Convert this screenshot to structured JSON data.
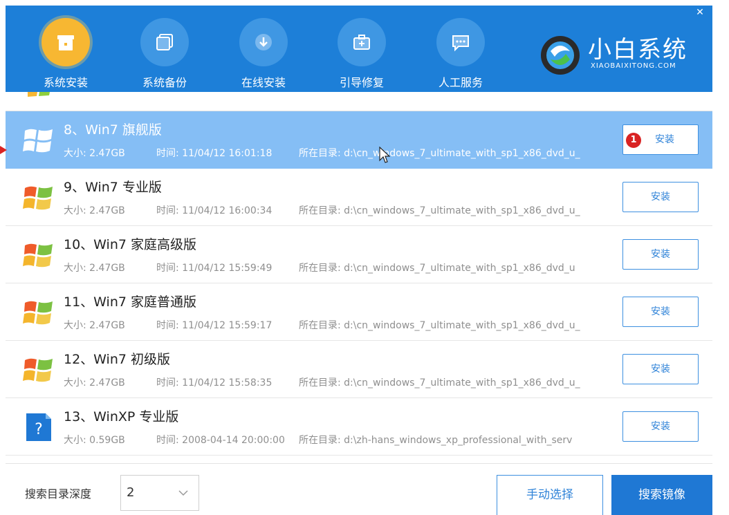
{
  "window": {
    "close_glyph": "✕"
  },
  "nav": {
    "items": [
      {
        "label": "系统安装",
        "icon": "install-box-icon",
        "active": true
      },
      {
        "label": "系统备份",
        "icon": "backup-icon",
        "active": false
      },
      {
        "label": "在线安装",
        "icon": "download-icon",
        "active": false
      },
      {
        "label": "引导修复",
        "icon": "toolbox-icon",
        "active": false
      },
      {
        "label": "人工服务",
        "icon": "chat-icon",
        "active": false
      }
    ]
  },
  "brand": {
    "title": "小白系统",
    "subtitle": "XIAOBAIXITONG.COM"
  },
  "list": {
    "rows": [
      {
        "title": "8、Win7 旗舰版",
        "size": "大小: 2.47GB",
        "time": "时间: 11/04/12 16:01:18",
        "path": "所在目录: d:\\cn_windows_7_ultimate_with_sp1_x86_dvd_u_",
        "icon": "windows-flag-icon",
        "selected": true,
        "button": "安装",
        "badge": "1"
      },
      {
        "title": "9、Win7 专业版",
        "size": "大小: 2.47GB",
        "time": "时间: 11/04/12 16:00:34",
        "path": "所在目录: d:\\cn_windows_7_ultimate_with_sp1_x86_dvd_u_",
        "icon": "windows-flag-icon",
        "selected": false,
        "button": "安装"
      },
      {
        "title": "10、Win7 家庭高级版",
        "size": "大小: 2.47GB",
        "time": "时间: 11/04/12 15:59:49",
        "path": "所在目录: d:\\cn_windows_7_ultimate_with_sp1_x86_dvd_u",
        "icon": "windows-flag-icon",
        "selected": false,
        "button": "安装"
      },
      {
        "title": "11、Win7 家庭普通版",
        "size": "大小: 2.47GB",
        "time": "时间: 11/04/12 15:59:17",
        "path": "所在目录: d:\\cn_windows_7_ultimate_with_sp1_x86_dvd_u_",
        "icon": "windows-flag-icon",
        "selected": false,
        "button": "安装"
      },
      {
        "title": "12、Win7 初级版",
        "size": "大小: 2.47GB",
        "time": "时间: 11/04/12 15:58:35",
        "path": "所在目录: d:\\cn_windows_7_ultimate_with_sp1_x86_dvd_u_",
        "icon": "windows-flag-icon",
        "selected": false,
        "button": "安装"
      },
      {
        "title": "13、WinXP 专业版",
        "size": "大小: 0.59GB",
        "time": "时间: 2008-04-14 20:00:00",
        "path": "所在目录: d:\\zh-hans_windows_xp_professional_with_serv",
        "icon": "unknown-file-icon",
        "selected": false,
        "button": "安装"
      }
    ]
  },
  "footer": {
    "depth_label": "搜索目录深度",
    "depth_value": "2",
    "manual_button": "手动选择",
    "search_button": "搜索镜像"
  },
  "colors": {
    "header_bg": "#1d7fd8",
    "selected_row": "#85bef5",
    "accent": "#2f83d8",
    "active_nav": "#f7b732",
    "badge": "#d92323"
  }
}
